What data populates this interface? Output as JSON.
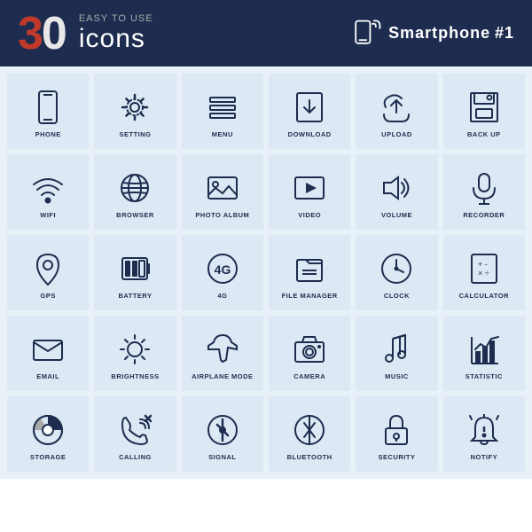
{
  "header": {
    "number": "30",
    "easy_label": "Easy To Use",
    "icons_label": "icons",
    "smartphone_label": "Smartphone",
    "hashtag": "#1"
  },
  "icons": [
    {
      "id": "phone",
      "label": "PHONE"
    },
    {
      "id": "setting",
      "label": "SETTING"
    },
    {
      "id": "menu",
      "label": "MENU"
    },
    {
      "id": "download",
      "label": "DOWNLOAD"
    },
    {
      "id": "upload",
      "label": "UPLOAD"
    },
    {
      "id": "backup",
      "label": "BACK UP"
    },
    {
      "id": "wifi",
      "label": "WIFI"
    },
    {
      "id": "browser",
      "label": "BROWSER"
    },
    {
      "id": "photo",
      "label": "PHOTO ALBUM"
    },
    {
      "id": "video",
      "label": "VIDEO"
    },
    {
      "id": "volume",
      "label": "VOLUME"
    },
    {
      "id": "recorder",
      "label": "RECORDER"
    },
    {
      "id": "gps",
      "label": "GPS"
    },
    {
      "id": "battery",
      "label": "BATTERY"
    },
    {
      "id": "4g",
      "label": "4G"
    },
    {
      "id": "filemanager",
      "label": "FILE MANAGER"
    },
    {
      "id": "clock",
      "label": "CLOCK"
    },
    {
      "id": "calculator",
      "label": "CALCULATOR"
    },
    {
      "id": "email",
      "label": "EMAIL"
    },
    {
      "id": "brightness",
      "label": "BRIGHTNESS"
    },
    {
      "id": "airplane",
      "label": "AIRPLANE MODE"
    },
    {
      "id": "camera",
      "label": "CAMERA"
    },
    {
      "id": "music",
      "label": "MUSIC"
    },
    {
      "id": "statistic",
      "label": "STATISTIC"
    },
    {
      "id": "storage",
      "label": "STORAGE"
    },
    {
      "id": "calling",
      "label": "CALLING"
    },
    {
      "id": "signal",
      "label": "SIGNAL"
    },
    {
      "id": "bluetooth",
      "label": "BLUETOOTH"
    },
    {
      "id": "security",
      "label": "SECURITY"
    },
    {
      "id": "notify",
      "label": "NOTIFY"
    }
  ]
}
